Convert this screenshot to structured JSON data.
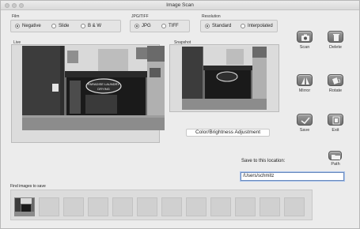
{
  "window": {
    "title": "Image Scan"
  },
  "film": {
    "label": "Film",
    "options": [
      {
        "label": "Negative",
        "selected": true
      },
      {
        "label": "Slide",
        "selected": false
      },
      {
        "label": "B & W",
        "selected": false
      }
    ]
  },
  "format": {
    "label": "JPG/TIFF",
    "options": [
      {
        "label": "JPG",
        "selected": true
      },
      {
        "label": "TIFF",
        "selected": false
      }
    ]
  },
  "resolution": {
    "label": "Resolution",
    "options": [
      {
        "label": "Standard",
        "selected": true
      },
      {
        "label": "Interpolated",
        "selected": false
      }
    ]
  },
  "live": {
    "label": "Live"
  },
  "snapshot": {
    "label": "Snapshot"
  },
  "photo_sign": {
    "line1": "PARADISE LAUNDRY",
    "line2": "DRYING"
  },
  "actions": {
    "scan": "Scan",
    "delete": "Delete",
    "mirror": "Mirror",
    "rotate": "Rotate",
    "save": "Save",
    "exit": "Exit",
    "path": "Path"
  },
  "icons": {
    "scan": "camera-icon",
    "delete": "trash-icon",
    "mirror": "mirror-icon",
    "rotate": "rotate-icon",
    "save": "save-icon",
    "exit": "exit-icon",
    "path": "folder-icon"
  },
  "adjust": {
    "label": "Color/Brightness Adjustment"
  },
  "save_location": {
    "label": "Save to this location:",
    "value": "/Users/schmitz"
  },
  "thumbnails": {
    "label": "Find images to save",
    "count": 12,
    "filled": 1
  }
}
